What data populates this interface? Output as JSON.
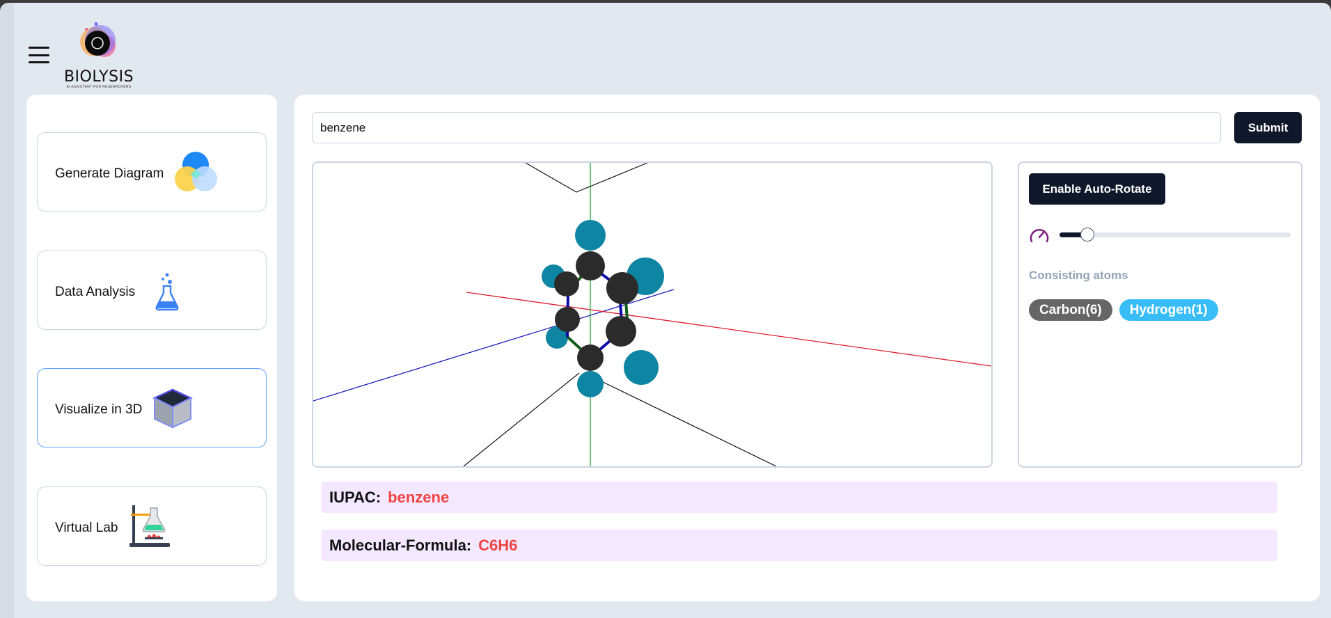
{
  "app": {
    "logo_text": "BIOLYSIS",
    "logo_subtitle": "AI ASSISTANT FOR RESEARCHERS"
  },
  "sidebar": {
    "items": [
      {
        "label": "Generate Diagram",
        "icon": "venn-diagram-icon",
        "active": false
      },
      {
        "label": "Data Analysis",
        "icon": "flask-icon",
        "active": false
      },
      {
        "label": "Visualize in 3D",
        "icon": "cube-icon",
        "active": true
      },
      {
        "label": "Virtual Lab",
        "icon": "lab-setup-icon",
        "active": false
      }
    ]
  },
  "search": {
    "value": "benzene",
    "submit_label": "Submit"
  },
  "controls": {
    "auto_rotate_label": "Enable Auto-Rotate",
    "rotation_speed": 0.12,
    "atoms_label": "Consisting atoms",
    "atoms": [
      {
        "label": "Carbon(6)",
        "color": "#666666"
      },
      {
        "label": "Hydrogen(1)",
        "color": "#38bdf8"
      }
    ]
  },
  "info": {
    "iupac_key": "IUPAC:",
    "iupac_value": "benzene",
    "formula_key": "Molecular-Formula:",
    "formula_value": "C6H6"
  },
  "colors": {
    "primary": "#0f172a",
    "accent": "#ef4444",
    "carbon": "#2b2b2b",
    "hydrogen": "#0e85a3"
  }
}
